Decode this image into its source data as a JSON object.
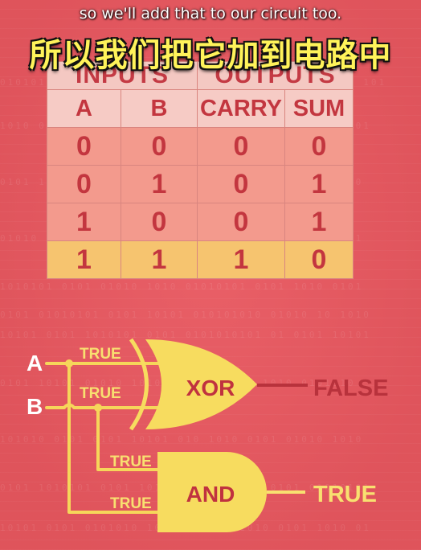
{
  "subtitles": {
    "english": "so we'll add that to our circuit too.",
    "chinese": "所以我们把它加到电路中"
  },
  "truth_table": {
    "group_headers": [
      "INPUTS",
      "OUTPUTS"
    ],
    "columns": [
      "A",
      "B",
      "CARRY",
      "SUM"
    ],
    "rows": [
      [
        "0",
        "0",
        "0",
        "0"
      ],
      [
        "0",
        "1",
        "0",
        "1"
      ],
      [
        "1",
        "0",
        "0",
        "1"
      ],
      [
        "1",
        "1",
        "1",
        "0"
      ]
    ],
    "highlighted_row": 3
  },
  "circuit": {
    "inputs": {
      "a": "A",
      "b": "B"
    },
    "wire_labels": {
      "xor_in_a": "TRUE",
      "xor_in_b": "TRUE",
      "and_in_b": "TRUE",
      "and_in_a": "TRUE"
    },
    "gates": {
      "xor": "XOR",
      "and": "AND"
    },
    "outputs": {
      "xor": "FALSE",
      "and": "TRUE"
    }
  },
  "colors": {
    "background": "#e8575f",
    "wire": "#f6d65a",
    "gate_fill": "#f7dc5f",
    "gate_text": "#c0323f",
    "false_wire": "#b8323c",
    "true_wire": "#f8e070"
  }
}
